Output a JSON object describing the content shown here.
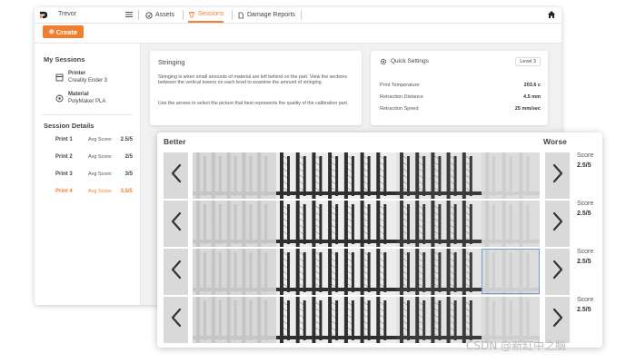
{
  "topbar": {
    "user": "Trevor",
    "nav": [
      {
        "label": "Assets",
        "icon": "assets-icon"
      },
      {
        "label": "Sessions",
        "icon": "sessions-icon",
        "active": true
      },
      {
        "label": "Damage Reports",
        "icon": "document-icon"
      }
    ]
  },
  "create_label": "Create",
  "sidebar": {
    "my_sessions_title": "My Sessions",
    "printer": {
      "title": "Printer",
      "value": "Creality Ender 3"
    },
    "material": {
      "title": "Material",
      "value": "PolyMaker PLA"
    },
    "session_details_title": "Session Details",
    "prints": [
      {
        "name": "Print 1",
        "avg_label": "Avg Score:",
        "score": "2.5/5",
        "active": false
      },
      {
        "name": "Print 2",
        "avg_label": "Avg Score:",
        "score": "2/5",
        "active": false
      },
      {
        "name": "Print 3",
        "avg_label": "Avg Score:",
        "score": "3/5",
        "active": false
      },
      {
        "name": "Print 4",
        "avg_label": "Avg Score:",
        "score": "3.5/5",
        "active": true
      }
    ]
  },
  "stringing": {
    "title": "Stringing",
    "para1": "Stringing is when small amounts of material are left behind on the part. View the sections between the vertical towers on each level to examine the amount of stringing.",
    "para2": "Use the arrows to select the picture that best represents the quality of the calibration part."
  },
  "quick_settings": {
    "title": "Quick Settings",
    "level": "Level 3",
    "rows": [
      {
        "label": "Print Temperature",
        "value": "203.6 c"
      },
      {
        "label": "Retraction Distance",
        "value": "4.5 mm"
      },
      {
        "label": "Retraction Speed",
        "value": "25 mm/sec"
      }
    ]
  },
  "comparison": {
    "better_label": "Better",
    "worse_label": "Worse",
    "rows": [
      {
        "score_label": "Score",
        "score": "2.5/5"
      },
      {
        "score_label": "Score",
        "score": "2.5/5"
      },
      {
        "score_label": "Score",
        "score": "2.5/5"
      },
      {
        "score_label": "Score",
        "score": "2.5/5"
      }
    ]
  },
  "watermark": "CSDN @新缸中之脑",
  "colors": {
    "accent": "#f08030",
    "arrow_bg": "#d9d9d9",
    "panel_bg": "#f1f1f1"
  }
}
